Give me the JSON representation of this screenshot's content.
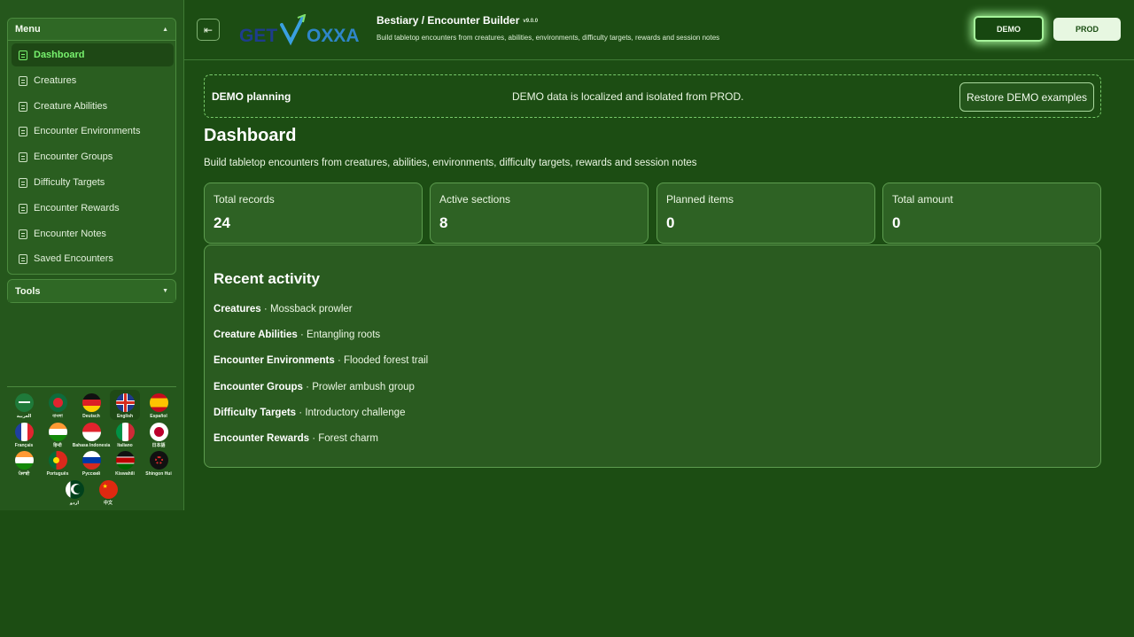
{
  "sidebar": {
    "menu_title": "Menu",
    "tools_title": "Tools",
    "items": [
      {
        "label": "Dashboard"
      },
      {
        "label": "Creatures"
      },
      {
        "label": "Creature Abilities"
      },
      {
        "label": "Encounter Environments"
      },
      {
        "label": "Encounter Groups"
      },
      {
        "label": "Difficulty Targets"
      },
      {
        "label": "Encounter Rewards"
      },
      {
        "label": "Encounter Notes"
      },
      {
        "label": "Saved Encounters"
      }
    ],
    "languages": [
      {
        "label": "العربية"
      },
      {
        "label": "বাংলা"
      },
      {
        "label": "Deutsch"
      },
      {
        "label": "English"
      },
      {
        "label": "Español"
      },
      {
        "label": "Français"
      },
      {
        "label": "हिन्दी"
      },
      {
        "label": "Bahasa Indonesia"
      },
      {
        "label": "Italiano"
      },
      {
        "label": "日本語"
      },
      {
        "label": "ਪੰਜਾਬੀ"
      },
      {
        "label": "Português"
      },
      {
        "label": "Русский"
      },
      {
        "label": "Kiswahili"
      },
      {
        "label": "Shingon Hui"
      },
      {
        "label": "اردو"
      },
      {
        "label": "中文"
      }
    ]
  },
  "header": {
    "logo_text_left": "GET",
    "logo_text_right": "OXXA",
    "title": "Bestiary / Encounter Builder",
    "version": "v9.0.0",
    "subtitle": "Build tabletop encounters from creatures, abilities, environments, difficulty targets, rewards and session notes",
    "demo_label": "DEMO",
    "prod_label": "PROD"
  },
  "notice": {
    "title": "DEMO planning",
    "message": "DEMO data is localized and isolated from PROD.",
    "restore_label": "Restore DEMO examples"
  },
  "main": {
    "title": "Dashboard",
    "subtitle": "Build tabletop encounters from creatures, abilities, environments, difficulty targets, rewards and session notes",
    "stats": [
      {
        "label": "Total records",
        "value": "24"
      },
      {
        "label": "Active sections",
        "value": "8"
      },
      {
        "label": "Planned items",
        "value": "0"
      },
      {
        "label": "Total amount",
        "value": "0"
      }
    ],
    "activity_title": "Recent activity",
    "activity": [
      {
        "section": "Creatures",
        "sep": " · ",
        "item": "Mossback prowler"
      },
      {
        "section": "Creature Abilities",
        "sep": " · ",
        "item": "Entangling roots"
      },
      {
        "section": "Encounter Environments",
        "sep": " · ",
        "item": "Flooded forest trail"
      },
      {
        "section": "Encounter Groups",
        "sep": " · ",
        "item": "Prowler ambush group"
      },
      {
        "section": "Difficulty Targets",
        "sep": " · ",
        "item": "Introductory challenge"
      },
      {
        "section": "Encounter Rewards",
        "sep": " · ",
        "item": "Forest charm"
      }
    ]
  },
  "colors": {
    "background": "#1c4d13",
    "sidebar": "#25571c",
    "accent": "#78f26e",
    "card": "#2e6224",
    "card_border": "#5d9c4f"
  }
}
